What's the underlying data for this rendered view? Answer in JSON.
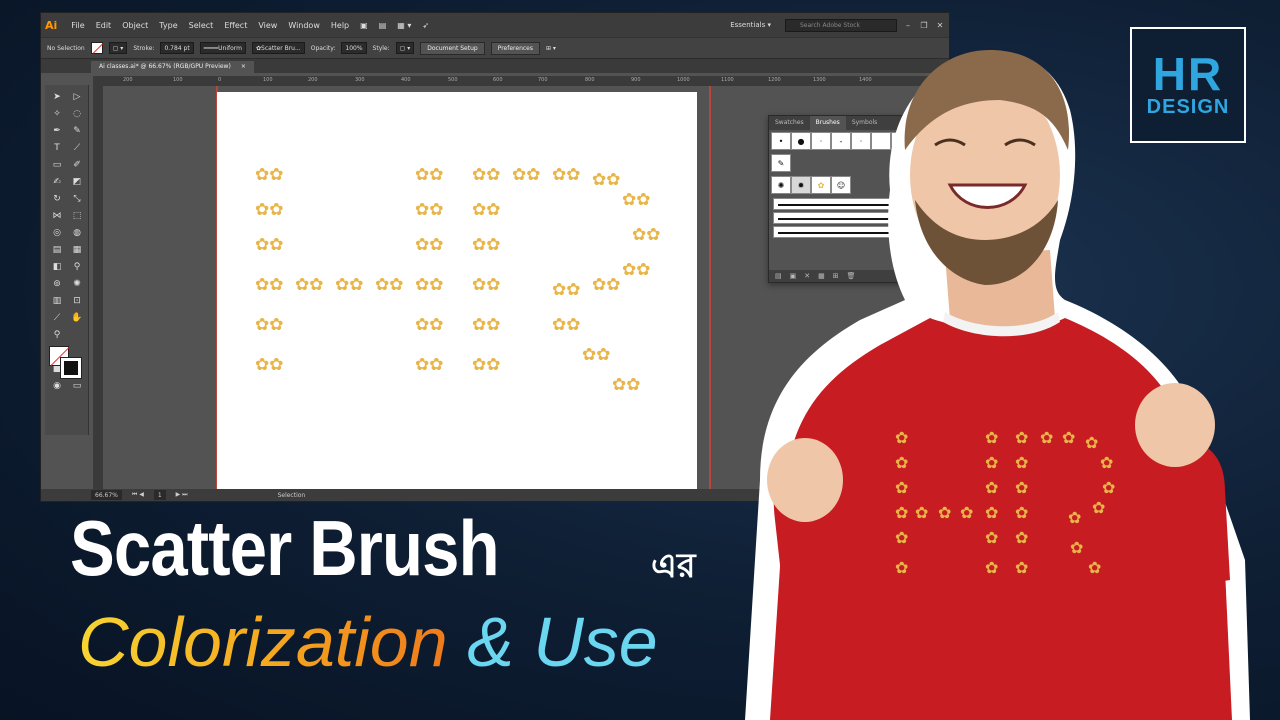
{
  "illustrator": {
    "app_logo": "Ai",
    "menu": [
      "File",
      "Edit",
      "Object",
      "Type",
      "Select",
      "Effect",
      "View",
      "Window",
      "Help"
    ],
    "workspace": "Essentials",
    "stock_search_placeholder": "Search Adobe Stock",
    "control_bar": {
      "selection": "No Selection",
      "stroke_label": "Stroke:",
      "stroke_value": "0.784 pt",
      "profile": "Uniform",
      "brush": "Scatter Bru...",
      "opacity_label": "Opacity:",
      "opacity_value": "100%",
      "style_label": "Style:",
      "document_setup": "Document Setup",
      "preferences": "Preferences"
    },
    "document_tab": "Ai classes.ai* @ 66.67% (RGB/GPU Preview)",
    "document_tab_close": "×",
    "ruler_marks": [
      "200",
      "100",
      "0",
      "100",
      "200",
      "300",
      "400",
      "500",
      "600",
      "700",
      "800",
      "900",
      "1000",
      "1100",
      "1200",
      "1300",
      "1400"
    ],
    "status_bar": {
      "zoom": "66.67%",
      "artboard": "1",
      "mode": "Selection"
    },
    "brushes_panel": {
      "tabs": [
        "Swatches",
        "Brushes",
        "Symbols"
      ],
      "active_tab": "Brushes"
    }
  },
  "logo": {
    "top": "HR",
    "bottom": "DESIGN",
    "color": "#2fa6e0"
  },
  "title": {
    "line1": "Scatter Brush",
    "suffix": "এর",
    "word1": "Colorization",
    "amp": "&",
    "word2": "Use"
  },
  "colors": {
    "flower": "#e8b548",
    "sweater": "#c71c22",
    "background": "#0e1e33",
    "accent_cyan": "#6bd6ef"
  }
}
